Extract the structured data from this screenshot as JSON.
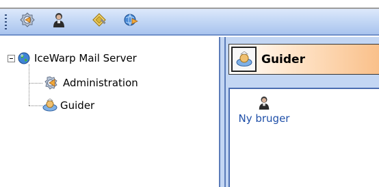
{
  "toolbar": {
    "buttons": [
      {
        "icon": "gear-wizard-icon"
      },
      {
        "icon": "user-icon"
      },
      {
        "icon": "key-icon"
      },
      {
        "icon": "globe-settings-icon"
      }
    ]
  },
  "tree": {
    "root": {
      "label": "IceWarp Mail Server",
      "icon": "globe-icon",
      "expanded": true
    },
    "children": [
      {
        "label": "Administration",
        "icon": "administration-icon"
      },
      {
        "label": "Guider",
        "icon": "wizard-icon"
      }
    ]
  },
  "panel": {
    "title": "Guider",
    "items": [
      {
        "label": "Ny bruger",
        "icon": "user-icon"
      }
    ]
  },
  "colors": {
    "toolbar": "#c4d8f5",
    "header_accent": "#f9c08a",
    "link": "#1f4fa8"
  }
}
